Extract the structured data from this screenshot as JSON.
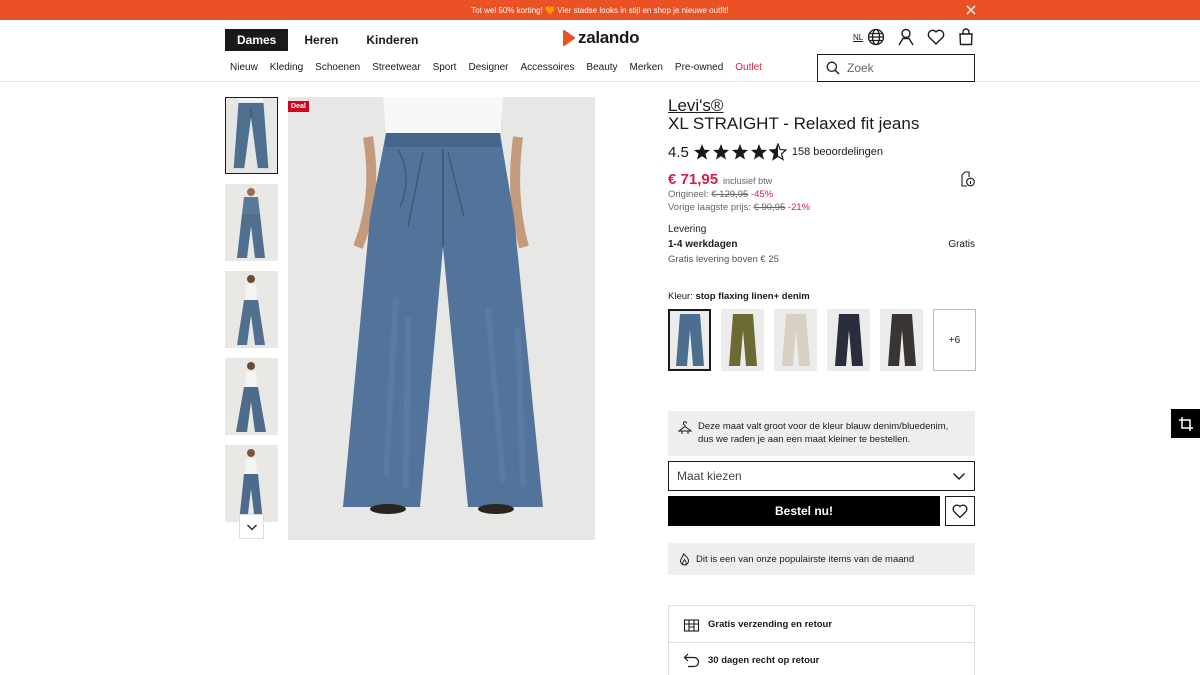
{
  "promo": {
    "text": "Tot wel 50% korting! 🧡 Vier stadse looks in stijl en shop je nieuwe outfit!",
    "close_icon": "close-icon"
  },
  "header": {
    "genders": [
      "Dames",
      "Heren",
      "Kinderen"
    ],
    "active_gender": "Dames",
    "logo_text": "zalando",
    "language": "NL",
    "icons": [
      "globe-icon",
      "account-icon",
      "wishlist-icon",
      "bag-icon"
    ]
  },
  "nav": {
    "items": [
      "Nieuw",
      "Kleding",
      "Schoenen",
      "Streetwear",
      "Sport",
      "Designer",
      "Accessoires",
      "Beauty",
      "Merken",
      "Pre-owned",
      "Outlet"
    ],
    "highlight_color": "#d3204a"
  },
  "search": {
    "placeholder": "Zoek"
  },
  "gallery": {
    "badge": "Deal",
    "thumb_count": 5,
    "active_thumb": 0
  },
  "product": {
    "brand": "Levi's®",
    "name": "XL STRAIGHT - Relaxed fit jeans",
    "rating": "4.5",
    "rating_value": 4.5,
    "reviews": "158 beoordelingen",
    "price": "€ 71,95",
    "vat": "inclusief btw",
    "original_label": "Origineel:",
    "original_price": "€ 129,95",
    "original_discount": "-45%",
    "previous_label": "Vorige laagste prijs:",
    "previous_price": "€ 90,95",
    "previous_discount": "-21%",
    "sale_color": "#d3204a"
  },
  "delivery": {
    "title": "Levering",
    "days": "1-4 werkdagen",
    "cost": "Gratis",
    "free_note": "Gratis levering boven € 25"
  },
  "color": {
    "label": "Kleur:",
    "value": "stop flaxing linen+ denim",
    "swatch_colors": [
      "#4d6f8e",
      "#6b6a32",
      "#d9d0c4",
      "#2a2d3b",
      "#3a3433"
    ],
    "more": "+6"
  },
  "fit_note": "Deze maat valt groot voor de kleur blauw denim/bluedenim, dus we raden je aan een maat kleiner te bestellen.",
  "size": {
    "placeholder": "Maat kiezen"
  },
  "buy_button": "Bestel nu!",
  "popular_note": "Dit is een van onze populairste items van de maand",
  "benefits": [
    {
      "icon": "gift-box-icon",
      "text": "Gratis verzending en retour"
    },
    {
      "icon": "return-arrow-icon",
      "text": "30 dagen recht op retour"
    }
  ]
}
